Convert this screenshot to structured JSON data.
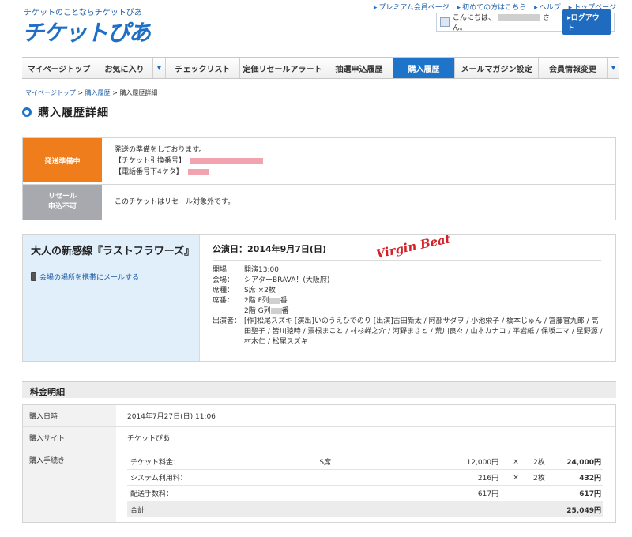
{
  "header": {
    "tagline": "チケットのことならチケットぴあ",
    "logo": "チケットぴあ",
    "util_links": [
      "プレミアム会員ページ",
      "初めての方はこちら",
      "ヘルプ",
      "トップページ"
    ],
    "greeting_prefix": "こんにちは、",
    "greeting_suffix": "さん。",
    "logout": "▸ログアウト"
  },
  "nav": {
    "items": [
      {
        "label": "マイページトップ",
        "w": 94
      },
      {
        "label": "お気に入り",
        "w": 88,
        "dropdown": true
      },
      {
        "label": "チェックリスト",
        "w": 94
      },
      {
        "label": "定価リセールアラート",
        "w": 108
      },
      {
        "label": "抽選申込履歴",
        "w": 86
      },
      {
        "label": "購入履歴",
        "w": 78,
        "active": true
      },
      {
        "label": "メールマガジン設定",
        "w": 106
      },
      {
        "label": "会員情報変更",
        "w": 102,
        "dropdown": true
      }
    ],
    "dropdown_glyph": "▼"
  },
  "breadcrumb": {
    "items": [
      "マイページトップ",
      "購入履歴",
      "購入履歴詳細"
    ],
    "sep": " > "
  },
  "page_title": "購入履歴詳細",
  "status": {
    "shipping_label": "発送準備中",
    "shipping_lines": [
      "発送の準備をしております。",
      "【チケット引換番号】",
      "【電話番号下4ケタ】"
    ],
    "resale_label_1": "リセール",
    "resale_label_2": "申込不可",
    "resale_text": "このチケットはリセール対象外です。"
  },
  "performance": {
    "name": "大人の新感線『ラストフラワーズ』",
    "mail_link": "会場の場所を携帯にメールする",
    "date": "公演日：2014年9月7日(日)",
    "virgin_beat": "Virgin Beat",
    "opening_label": "開場",
    "opening_value": "開演13:00",
    "venue_label": "会場：",
    "venue_value": "シアターBRAVA！(大阪府)",
    "seat_type_label": "席種：",
    "seat_type_value": "S席 ×2枚",
    "seat_no_label": "席番：",
    "seat_no_1a": "2階 F列",
    "seat_no_1b": "番",
    "seat_no_2a": "2階 G列",
    "seat_no_2b": "番",
    "cast_label": "出演者：",
    "cast_value": "[作]松尾スズキ [演出]いのうえひでのり [出演]古田新太 / 阿部サダヲ / 小池栄子 / 橋本じゅん / 宮藤官九郎 / 高田聖子 / 皆川猿時 / 粟根まこと / 村杉蝉之介 / 河野まさと / 荒川良々 / 山本カナコ / 平岩紙 / 保坂エマ / 星野源 / 村木仁 / 松尾スズキ"
  },
  "fees": {
    "title": "料金明細",
    "purchase_date_label": "購入日時",
    "purchase_date": "2014年7月27日(日) 11:06",
    "site_label": "購入サイト",
    "site": "チケットぴあ",
    "procedure_label": "購入手続き",
    "rows": [
      {
        "name": "チケット料金：",
        "type": "S席",
        "unit": "12,000円",
        "x": "×",
        "qty": "2枚",
        "amount": "24,000円"
      },
      {
        "name": "システム利用料：",
        "type": "",
        "unit": "216円",
        "x": "×",
        "qty": "2枚",
        "amount": "432円"
      },
      {
        "name": "配送手数料：",
        "type": "",
        "unit": "617円",
        "x": "",
        "qty": "",
        "amount": "617円"
      }
    ],
    "total_label": "合計",
    "total": "25,049円"
  },
  "colors": {
    "brand_blue": "#1e74c9",
    "orange": "#ef7d1b",
    "gray": "#a7a9ae",
    "red": "#d42027"
  }
}
